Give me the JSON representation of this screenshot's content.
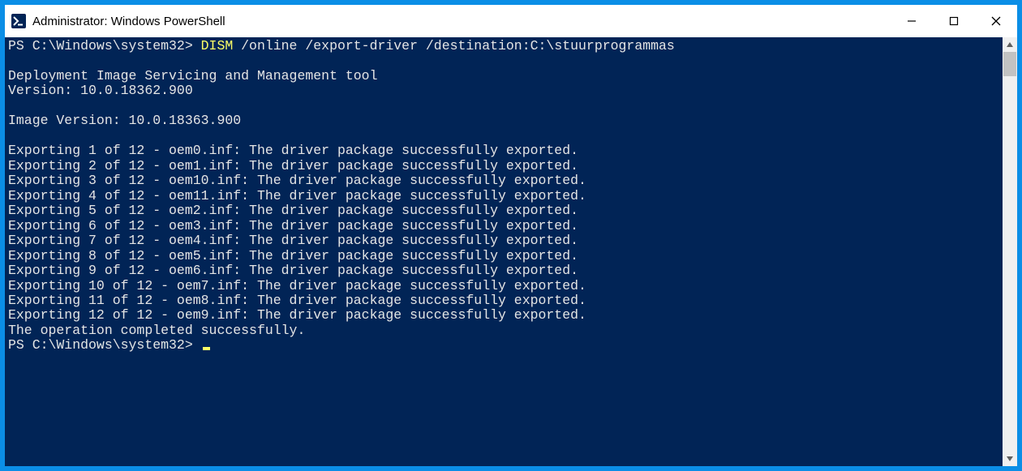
{
  "titlebar": {
    "title": "Administrator: Windows PowerShell"
  },
  "terminal": {
    "prompt": "PS C:\\Windows\\system32>",
    "command_keyword": "DISM",
    "command_rest": "/online /export-driver /destination:C:\\stuurprogrammas",
    "lines": [
      "",
      "Deployment Image Servicing and Management tool",
      "Version: 10.0.18362.900",
      "",
      "Image Version: 10.0.18363.900",
      "",
      "Exporting 1 of 12 - oem0.inf: The driver package successfully exported.",
      "Exporting 2 of 12 - oem1.inf: The driver package successfully exported.",
      "Exporting 3 of 12 - oem10.inf: The driver package successfully exported.",
      "Exporting 4 of 12 - oem11.inf: The driver package successfully exported.",
      "Exporting 5 of 12 - oem2.inf: The driver package successfully exported.",
      "Exporting 6 of 12 - oem3.inf: The driver package successfully exported.",
      "Exporting 7 of 12 - oem4.inf: The driver package successfully exported.",
      "Exporting 8 of 12 - oem5.inf: The driver package successfully exported.",
      "Exporting 9 of 12 - oem6.inf: The driver package successfully exported.",
      "Exporting 10 of 12 - oem7.inf: The driver package successfully exported.",
      "Exporting 11 of 12 - oem8.inf: The driver package successfully exported.",
      "Exporting 12 of 12 - oem9.inf: The driver package successfully exported.",
      "The operation completed successfully."
    ],
    "prompt2": "PS C:\\Windows\\system32>"
  }
}
